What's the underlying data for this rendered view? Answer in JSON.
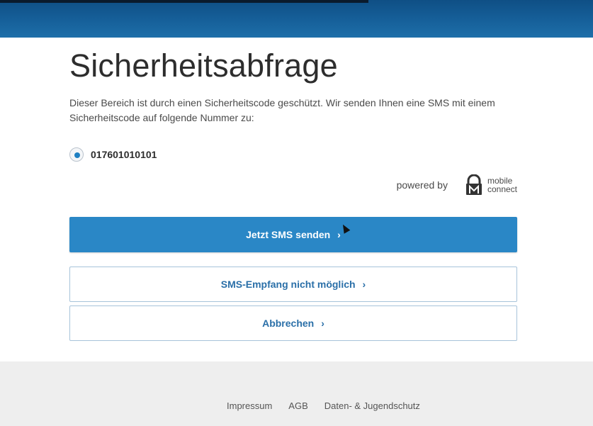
{
  "page": {
    "title": "Sicherheitsabfrage",
    "intro": "Dieser Bereich ist durch einen Sicherheitscode geschützt. Wir senden Ihnen eine SMS mit einem Sicherheitscode auf folgende Nummer zu:"
  },
  "phone": {
    "number": "017601010101",
    "selected": true
  },
  "powered": {
    "label": "powered by",
    "brand_line1": "mobile",
    "brand_line2": "connect"
  },
  "buttons": {
    "send_sms": "Jetzt SMS senden",
    "sms_not_possible": "SMS-Empfang nicht möglich",
    "cancel": "Abbrechen",
    "chevron": "›"
  },
  "footer": {
    "impressum": "Impressum",
    "agb": "AGB",
    "datenschutz": "Daten- & Jugendschutz"
  },
  "colors": {
    "header": "#16609a",
    "primary": "#2a87c6",
    "link": "#2a6fa8",
    "footer_bg": "#eeeeee"
  }
}
